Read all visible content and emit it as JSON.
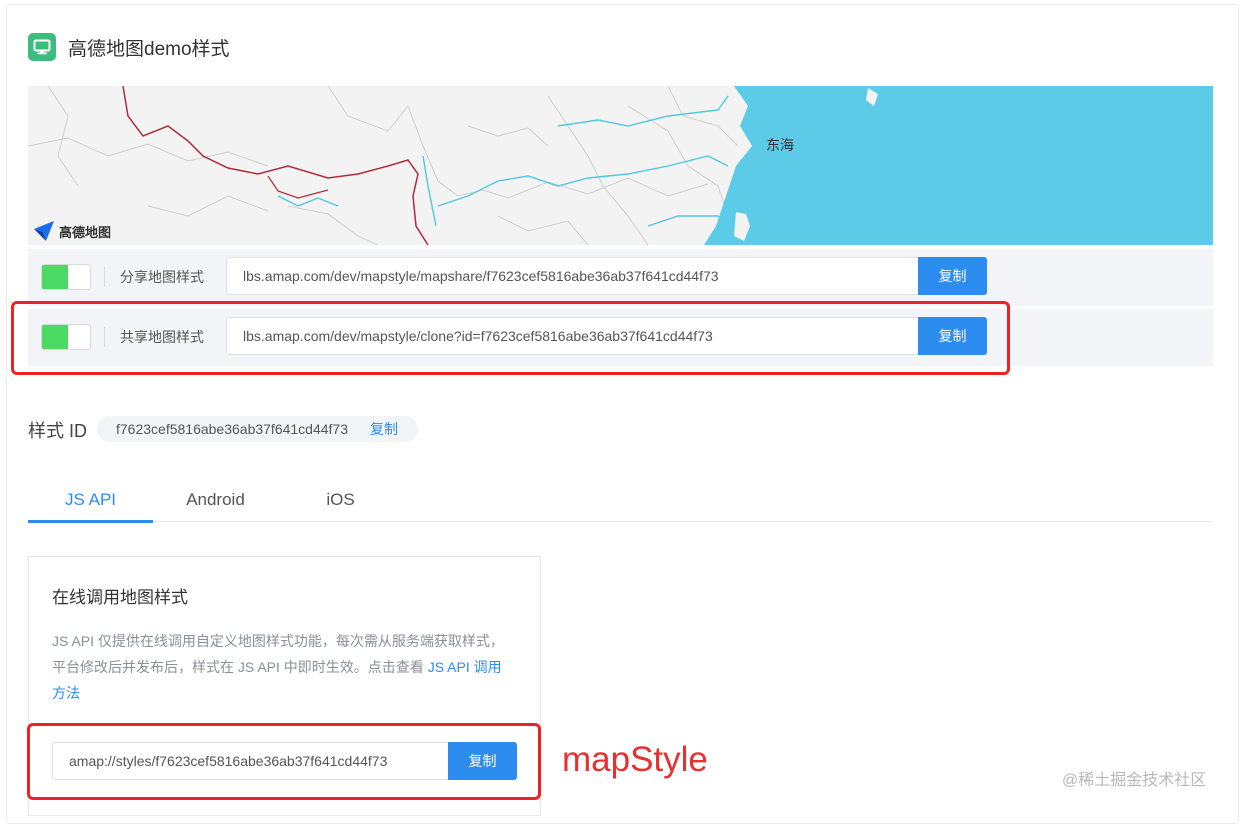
{
  "page": {
    "title": "高德地图demo样式"
  },
  "map": {
    "sea_label": "东海",
    "logo_text": "高德地图",
    "colors": {
      "land": "#f3f3f3",
      "sea": "#5ccbe8",
      "border": "#b02a3a",
      "river": "#4fc8e0",
      "province": "#cfcfcf"
    }
  },
  "share_rows": [
    {
      "label": "分享地图样式",
      "url": "lbs.amap.com/dev/mapstyle/mapshare/f7623cef5816abe36ab37f641cd44f73",
      "copy_label": "复制",
      "enabled": true
    },
    {
      "label": "共享地图样式",
      "url": "lbs.amap.com/dev/mapstyle/clone?id=f7623cef5816abe36ab37f641cd44f73",
      "copy_label": "复制",
      "enabled": true
    }
  ],
  "style_id": {
    "label": "样式 ID",
    "value": "f7623cef5816abe36ab37f641cd44f73",
    "copy_label": "复制"
  },
  "tabs": [
    {
      "label": "JS API",
      "active": true
    },
    {
      "label": "Android",
      "active": false
    },
    {
      "label": "iOS",
      "active": false
    }
  ],
  "panel": {
    "title": "在线调用地图样式",
    "desc_text": "JS API 仅提供在线调用自定义地图样式功能，每次需从服务端获取样式，平台修改后并发布后，样式在 JS API 中即时生效。点击查看",
    "desc_link": "JS API 调用方法",
    "mapstyle_value": "amap://styles/f7623cef5816abe36ab37f641cd44f73",
    "copy_label": "复制"
  },
  "annotation": "mapStyle",
  "watermark": "@稀土掘金技术社区",
  "colors": {
    "accent": "#2d8cf0",
    "toggle_on": "#4cd964",
    "highlight": "#ee2222",
    "icon_bg": "#3dbd7d"
  }
}
